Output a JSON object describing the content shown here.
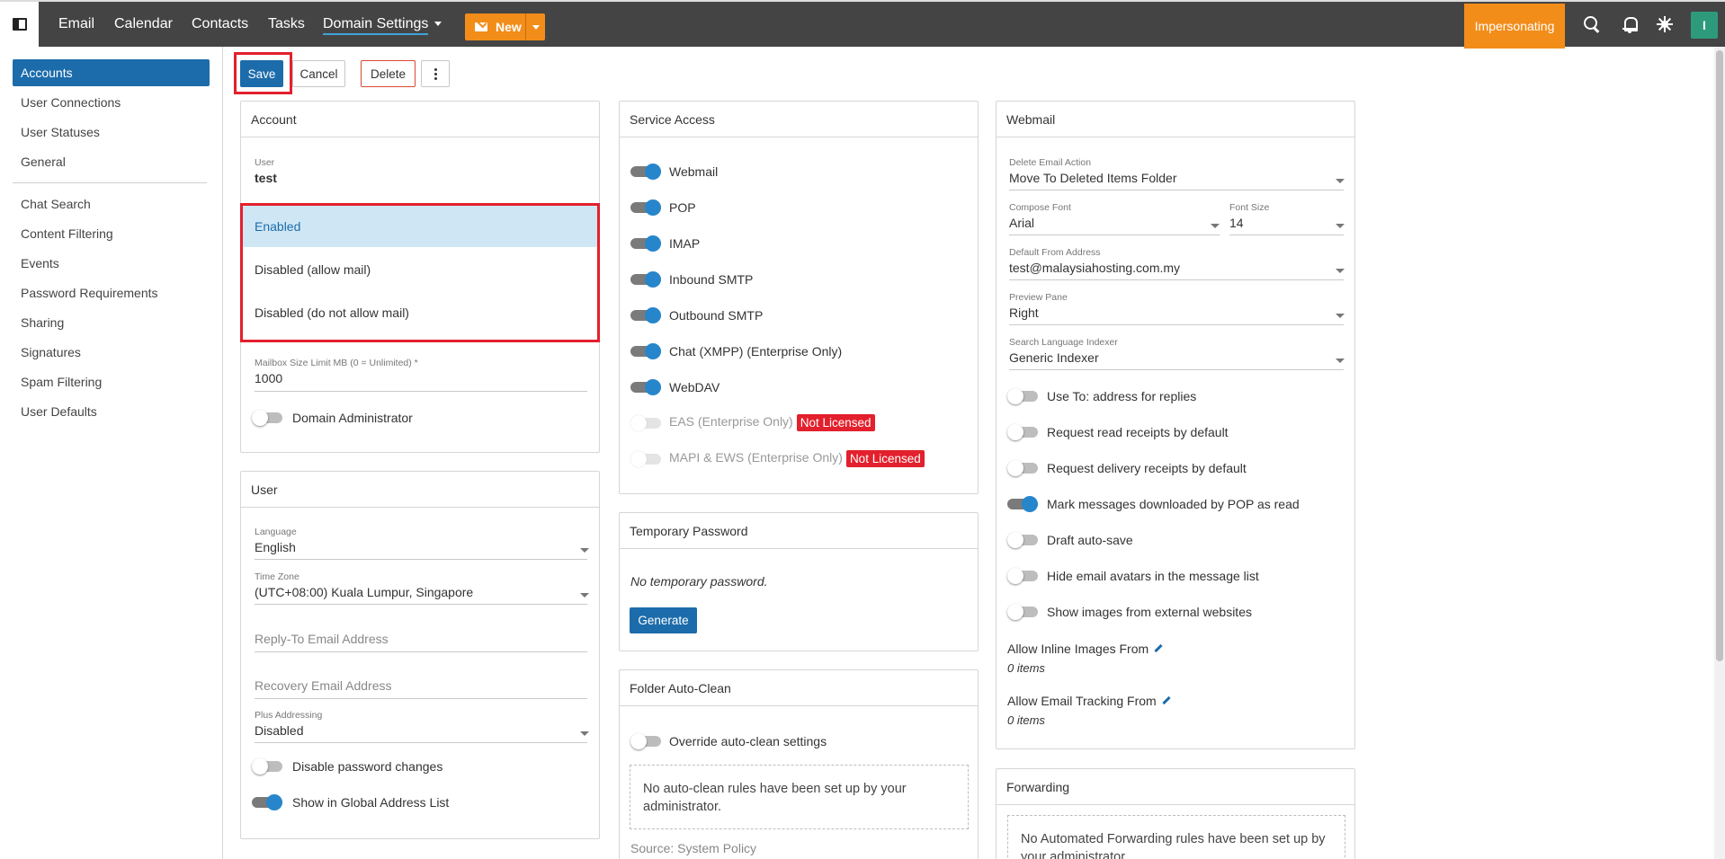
{
  "topbar": {
    "nav": [
      {
        "label": "Email"
      },
      {
        "label": "Calendar"
      },
      {
        "label": "Contacts"
      },
      {
        "label": "Tasks"
      },
      {
        "label": "Domain Settings"
      }
    ],
    "new_label": "New",
    "impersonating_label": "Impersonating",
    "avatar_initial": "I"
  },
  "sidebar": {
    "items": [
      {
        "label": "Accounts"
      },
      {
        "label": "User Connections"
      },
      {
        "label": "User Statuses"
      },
      {
        "label": "General"
      },
      {
        "label": "Chat Search"
      },
      {
        "label": "Content Filtering"
      },
      {
        "label": "Events"
      },
      {
        "label": "Password Requirements"
      },
      {
        "label": "Sharing"
      },
      {
        "label": "Signatures"
      },
      {
        "label": "Spam Filtering"
      },
      {
        "label": "User Defaults"
      }
    ]
  },
  "toolbar": {
    "save_label": "Save",
    "cancel_label": "Cancel",
    "delete_label": "Delete"
  },
  "account": {
    "title": "Account",
    "user_label": "User",
    "user_value": "test",
    "status_options": [
      "Enabled",
      "Disabled (allow mail)",
      "Disabled (do not allow mail)"
    ],
    "mailbox_label": "Mailbox Size Limit MB (0 = Unlimited) *",
    "mailbox_value": "1000",
    "domain_admin_label": "Domain Administrator"
  },
  "user": {
    "title": "User",
    "language_label": "Language",
    "language_value": "English",
    "timezone_label": "Time Zone",
    "timezone_value": "(UTC+08:00) Kuala Lumpur, Singapore",
    "reply_to_placeholder": "Reply-To Email Address",
    "recovery_placeholder": "Recovery Email Address",
    "plus_label": "Plus Addressing",
    "plus_value": "Disabled",
    "disable_pw_label": "Disable password changes",
    "show_gal_label": "Show in Global Address List"
  },
  "service_access": {
    "title": "Service Access",
    "items": [
      {
        "label": "Webmail"
      },
      {
        "label": "POP"
      },
      {
        "label": "IMAP"
      },
      {
        "label": "Inbound SMTP"
      },
      {
        "label": "Outbound SMTP"
      },
      {
        "label": "Chat (XMPP) (Enterprise Only)"
      },
      {
        "label": "WebDAV"
      },
      {
        "label": "EAS (Enterprise Only)",
        "badge": "Not Licensed"
      },
      {
        "label": "MAPI & EWS (Enterprise Only)",
        "badge": "Not Licensed"
      }
    ]
  },
  "temp_password": {
    "title": "Temporary Password",
    "text": "No temporary password.",
    "generate_label": "Generate"
  },
  "folder_autoclean": {
    "title": "Folder Auto-Clean",
    "override_label": "Override auto-clean settings",
    "empty_text": "No auto-clean rules have been set up by your administrator.",
    "source_text": "Source: System Policy"
  },
  "webmail": {
    "title": "Webmail",
    "delete_action_label": "Delete Email Action",
    "delete_action_value": "Move To Deleted Items Folder",
    "compose_font_label": "Compose Font",
    "compose_font_value": "Arial",
    "font_size_label": "Font Size",
    "font_size_value": "14",
    "from_label": "Default From Address",
    "from_value": "test@malaysiahosting.com.my",
    "preview_label": "Preview Pane",
    "preview_value": "Right",
    "indexer_label": "Search Language Indexer",
    "indexer_value": "Generic Indexer",
    "toggles": [
      {
        "label": "Use To: address for replies"
      },
      {
        "label": "Request read receipts by default"
      },
      {
        "label": "Request delivery receipts by default"
      },
      {
        "label": "Mark messages downloaded by POP as read"
      },
      {
        "label": "Draft auto-save"
      },
      {
        "label": "Hide email avatars in the message list"
      },
      {
        "label": "Show images from external websites"
      }
    ],
    "inline_images_label": "Allow Inline Images From",
    "inline_images_count": "0 items",
    "tracking_label": "Allow Email Tracking From",
    "tracking_count": "0 items"
  },
  "forwarding": {
    "title": "Forwarding",
    "empty_text": "No Automated Forwarding rules have been set up by your administrator."
  }
}
